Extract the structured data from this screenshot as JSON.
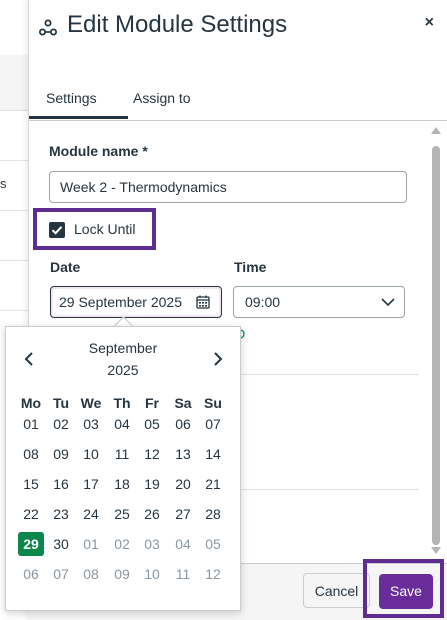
{
  "tray": {
    "title": "Edit Module Settings",
    "close_label": "×"
  },
  "background": {
    "visible_letter": "s"
  },
  "tabs": [
    {
      "label": "Settings",
      "active": true
    },
    {
      "label": "Assign to",
      "active": false
    }
  ],
  "form": {
    "module_name_label": "Module name *",
    "module_name_value": "Week 2 - Thermodynamics",
    "lock_until_label": "Lock Until",
    "lock_until_checked": true,
    "date_label": "Date",
    "date_value": "29 September 2025",
    "time_label": "Time",
    "time_value": "09:00"
  },
  "calendar": {
    "month": "September",
    "year": "2025",
    "weekdays": [
      "Mo",
      "Tu",
      "We",
      "Th",
      "Fr",
      "Sa",
      "Su"
    ],
    "weeks": [
      [
        {
          "d": "01"
        },
        {
          "d": "02"
        },
        {
          "d": "03"
        },
        {
          "d": "04"
        },
        {
          "d": "05"
        },
        {
          "d": "06"
        },
        {
          "d": "07"
        }
      ],
      [
        {
          "d": "08"
        },
        {
          "d": "09"
        },
        {
          "d": "10"
        },
        {
          "d": "11"
        },
        {
          "d": "12"
        },
        {
          "d": "13"
        },
        {
          "d": "14"
        }
      ],
      [
        {
          "d": "15"
        },
        {
          "d": "16"
        },
        {
          "d": "17"
        },
        {
          "d": "18"
        },
        {
          "d": "19"
        },
        {
          "d": "20"
        },
        {
          "d": "21"
        }
      ],
      [
        {
          "d": "22"
        },
        {
          "d": "23"
        },
        {
          "d": "24"
        },
        {
          "d": "25"
        },
        {
          "d": "26"
        },
        {
          "d": "27"
        },
        {
          "d": "28"
        }
      ],
      [
        {
          "d": "29",
          "selected": true
        },
        {
          "d": "30"
        },
        {
          "d": "01",
          "muted": true
        },
        {
          "d": "02",
          "muted": true
        },
        {
          "d": "03",
          "muted": true
        },
        {
          "d": "04",
          "muted": true
        },
        {
          "d": "05",
          "muted": true
        }
      ],
      [
        {
          "d": "06",
          "muted": true
        },
        {
          "d": "07",
          "muted": true
        },
        {
          "d": "08",
          "muted": true
        },
        {
          "d": "09",
          "muted": true
        },
        {
          "d": "10",
          "muted": true
        },
        {
          "d": "11",
          "muted": true
        },
        {
          "d": "12",
          "muted": true
        }
      ]
    ]
  },
  "footer": {
    "cancel_label": "Cancel",
    "save_label": "Save"
  },
  "colors": {
    "primary_text": "#273540",
    "selected_day": "#0b874b",
    "save_button": "#6a2c99",
    "highlight_box": "#5f2c91"
  }
}
